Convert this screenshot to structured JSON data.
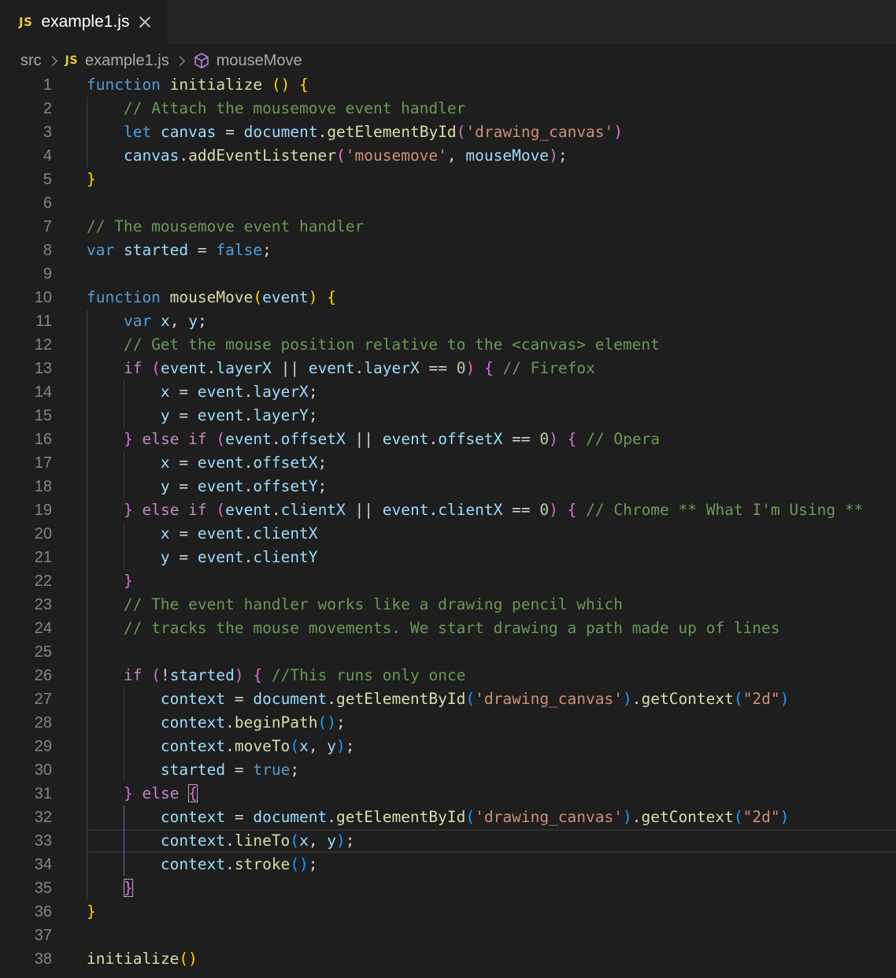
{
  "tab": {
    "badge": "JS",
    "title": "example1.js"
  },
  "breadcrumb": {
    "folder": "src",
    "file_badge": "JS",
    "file": "example1.js",
    "symbol": "mouseMove"
  },
  "colors": {
    "background": "#1e1e1e",
    "keyword": "#569cd6",
    "control": "#c586c0",
    "function": "#dcdcaa",
    "variable": "#9cdcfe",
    "string": "#ce9178",
    "comment": "#6a9955",
    "number": "#b5cea8",
    "bracket1": "#ffd700",
    "bracket2": "#da70d6",
    "bracket3": "#179fff",
    "js_badge": "#e8c93a"
  },
  "current_line": 33,
  "code": [
    [
      [
        "kw",
        "function"
      ],
      [
        "op",
        " "
      ],
      [
        "fn",
        "initialize"
      ],
      [
        "op",
        " "
      ],
      [
        "b1",
        "()"
      ],
      [
        "op",
        " "
      ],
      [
        "b1",
        "{"
      ]
    ],
    [
      [
        "op",
        "    "
      ],
      [
        "cmt",
        "// Attach the mousemove event handler"
      ]
    ],
    [
      [
        "op",
        "    "
      ],
      [
        "kw",
        "let"
      ],
      [
        "op",
        " "
      ],
      [
        "var",
        "canvas"
      ],
      [
        "op",
        " = "
      ],
      [
        "var",
        "document"
      ],
      [
        "op",
        "."
      ],
      [
        "fn",
        "getElementById"
      ],
      [
        "b2",
        "("
      ],
      [
        "str",
        "'drawing_canvas'"
      ],
      [
        "b2",
        ")"
      ]
    ],
    [
      [
        "op",
        "    "
      ],
      [
        "var",
        "canvas"
      ],
      [
        "op",
        "."
      ],
      [
        "fn",
        "addEventListener"
      ],
      [
        "b2",
        "("
      ],
      [
        "str",
        "'mousemove'"
      ],
      [
        "op",
        ", "
      ],
      [
        "var",
        "mouseMove"
      ],
      [
        "b2",
        ")"
      ],
      [
        "op",
        ";"
      ]
    ],
    [
      [
        "b1",
        "}"
      ]
    ],
    [],
    [
      [
        "cmt",
        "// The mousemove event handler"
      ]
    ],
    [
      [
        "kw",
        "var"
      ],
      [
        "op",
        " "
      ],
      [
        "var",
        "started"
      ],
      [
        "op",
        " = "
      ],
      [
        "kw",
        "false"
      ],
      [
        "op",
        ";"
      ]
    ],
    [],
    [
      [
        "kw",
        "function"
      ],
      [
        "op",
        " "
      ],
      [
        "fn",
        "mouseMove"
      ],
      [
        "b1",
        "("
      ],
      [
        "var",
        "event"
      ],
      [
        "b1",
        ")"
      ],
      [
        "op",
        " "
      ],
      [
        "b1",
        "{"
      ]
    ],
    [
      [
        "op",
        "    "
      ],
      [
        "kw",
        "var"
      ],
      [
        "op",
        " "
      ],
      [
        "var",
        "x"
      ],
      [
        "op",
        ", "
      ],
      [
        "var",
        "y"
      ],
      [
        "op",
        ";"
      ]
    ],
    [
      [
        "op",
        "    "
      ],
      [
        "cmt",
        "// Get the mouse position relative to the <canvas> element"
      ]
    ],
    [
      [
        "op",
        "    "
      ],
      [
        "ctl",
        "if"
      ],
      [
        "op",
        " "
      ],
      [
        "b2",
        "("
      ],
      [
        "var",
        "event"
      ],
      [
        "op",
        "."
      ],
      [
        "var",
        "layerX"
      ],
      [
        "op",
        " || "
      ],
      [
        "var",
        "event"
      ],
      [
        "op",
        "."
      ],
      [
        "var",
        "layerX"
      ],
      [
        "op",
        " == "
      ],
      [
        "num",
        "0"
      ],
      [
        "b2",
        ")"
      ],
      [
        "op",
        " "
      ],
      [
        "b2",
        "{"
      ],
      [
        "op",
        " "
      ],
      [
        "cmt",
        "// Firefox"
      ]
    ],
    [
      [
        "op",
        "        "
      ],
      [
        "var",
        "x"
      ],
      [
        "op",
        " = "
      ],
      [
        "var",
        "event"
      ],
      [
        "op",
        "."
      ],
      [
        "var",
        "layerX"
      ],
      [
        "op",
        ";"
      ]
    ],
    [
      [
        "op",
        "        "
      ],
      [
        "var",
        "y"
      ],
      [
        "op",
        " = "
      ],
      [
        "var",
        "event"
      ],
      [
        "op",
        "."
      ],
      [
        "var",
        "layerY"
      ],
      [
        "op",
        ";"
      ]
    ],
    [
      [
        "op",
        "    "
      ],
      [
        "b2",
        "}"
      ],
      [
        "op",
        " "
      ],
      [
        "ctl",
        "else if"
      ],
      [
        "op",
        " "
      ],
      [
        "b2",
        "("
      ],
      [
        "var",
        "event"
      ],
      [
        "op",
        "."
      ],
      [
        "var",
        "offsetX"
      ],
      [
        "op",
        " || "
      ],
      [
        "var",
        "event"
      ],
      [
        "op",
        "."
      ],
      [
        "var",
        "offsetX"
      ],
      [
        "op",
        " == "
      ],
      [
        "num",
        "0"
      ],
      [
        "b2",
        ")"
      ],
      [
        "op",
        " "
      ],
      [
        "b2",
        "{"
      ],
      [
        "op",
        " "
      ],
      [
        "cmt",
        "// Opera"
      ]
    ],
    [
      [
        "op",
        "        "
      ],
      [
        "var",
        "x"
      ],
      [
        "op",
        " = "
      ],
      [
        "var",
        "event"
      ],
      [
        "op",
        "."
      ],
      [
        "var",
        "offsetX"
      ],
      [
        "op",
        ";"
      ]
    ],
    [
      [
        "op",
        "        "
      ],
      [
        "var",
        "y"
      ],
      [
        "op",
        " = "
      ],
      [
        "var",
        "event"
      ],
      [
        "op",
        "."
      ],
      [
        "var",
        "offsetY"
      ],
      [
        "op",
        ";"
      ]
    ],
    [
      [
        "op",
        "    "
      ],
      [
        "b2",
        "}"
      ],
      [
        "op",
        " "
      ],
      [
        "ctl",
        "else if"
      ],
      [
        "op",
        " "
      ],
      [
        "b2",
        "("
      ],
      [
        "var",
        "event"
      ],
      [
        "op",
        "."
      ],
      [
        "var",
        "clientX"
      ],
      [
        "op",
        " || "
      ],
      [
        "var",
        "event"
      ],
      [
        "op",
        "."
      ],
      [
        "var",
        "clientX"
      ],
      [
        "op",
        " == "
      ],
      [
        "num",
        "0"
      ],
      [
        "b2",
        ")"
      ],
      [
        "op",
        " "
      ],
      [
        "b2",
        "{"
      ],
      [
        "op",
        " "
      ],
      [
        "cmt",
        "// Chrome ** What I'm Using **"
      ]
    ],
    [
      [
        "op",
        "        "
      ],
      [
        "var",
        "x"
      ],
      [
        "op",
        " = "
      ],
      [
        "var",
        "event"
      ],
      [
        "op",
        "."
      ],
      [
        "var",
        "clientX"
      ]
    ],
    [
      [
        "op",
        "        "
      ],
      [
        "var",
        "y"
      ],
      [
        "op",
        " = "
      ],
      [
        "var",
        "event"
      ],
      [
        "op",
        "."
      ],
      [
        "var",
        "clientY"
      ]
    ],
    [
      [
        "op",
        "    "
      ],
      [
        "b2",
        "}"
      ]
    ],
    [
      [
        "op",
        "    "
      ],
      [
        "cmt",
        "// The event handler works like a drawing pencil which"
      ]
    ],
    [
      [
        "op",
        "    "
      ],
      [
        "cmt",
        "// tracks the mouse movements. We start drawing a path made up of lines"
      ]
    ],
    [],
    [
      [
        "op",
        "    "
      ],
      [
        "ctl",
        "if"
      ],
      [
        "op",
        " "
      ],
      [
        "b2",
        "("
      ],
      [
        "op",
        "!"
      ],
      [
        "var",
        "started"
      ],
      [
        "b2",
        ")"
      ],
      [
        "op",
        " "
      ],
      [
        "b2",
        "{"
      ],
      [
        "op",
        " "
      ],
      [
        "cmt",
        "//This runs only once"
      ]
    ],
    [
      [
        "op",
        "        "
      ],
      [
        "var",
        "context"
      ],
      [
        "op",
        " = "
      ],
      [
        "var",
        "document"
      ],
      [
        "op",
        "."
      ],
      [
        "fn",
        "getElementById"
      ],
      [
        "b3",
        "("
      ],
      [
        "str",
        "'drawing_canvas'"
      ],
      [
        "b3",
        ")"
      ],
      [
        "op",
        "."
      ],
      [
        "fn",
        "getContext"
      ],
      [
        "b3",
        "("
      ],
      [
        "str",
        "\"2d\""
      ],
      [
        "b3",
        ")"
      ]
    ],
    [
      [
        "op",
        "        "
      ],
      [
        "var",
        "context"
      ],
      [
        "op",
        "."
      ],
      [
        "fn",
        "beginPath"
      ],
      [
        "b3",
        "()"
      ],
      [
        "op",
        ";"
      ]
    ],
    [
      [
        "op",
        "        "
      ],
      [
        "var",
        "context"
      ],
      [
        "op",
        "."
      ],
      [
        "fn",
        "moveTo"
      ],
      [
        "b3",
        "("
      ],
      [
        "var",
        "x"
      ],
      [
        "op",
        ", "
      ],
      [
        "var",
        "y"
      ],
      [
        "b3",
        ")"
      ],
      [
        "op",
        ";"
      ]
    ],
    [
      [
        "op",
        "        "
      ],
      [
        "var",
        "started"
      ],
      [
        "op",
        " = "
      ],
      [
        "kw",
        "true"
      ],
      [
        "op",
        ";"
      ]
    ],
    [
      [
        "op",
        "    "
      ],
      [
        "b2",
        "}"
      ],
      [
        "op",
        " "
      ],
      [
        "ctl",
        "else"
      ],
      [
        "op",
        " "
      ],
      [
        "b2 box",
        "{"
      ]
    ],
    [
      [
        "op",
        "        "
      ],
      [
        "var",
        "context"
      ],
      [
        "op",
        " = "
      ],
      [
        "var",
        "document"
      ],
      [
        "op",
        "."
      ],
      [
        "fn",
        "getElementById"
      ],
      [
        "b3",
        "("
      ],
      [
        "str",
        "'drawing_canvas'"
      ],
      [
        "b3",
        ")"
      ],
      [
        "op",
        "."
      ],
      [
        "fn",
        "getContext"
      ],
      [
        "b3",
        "("
      ],
      [
        "str",
        "\"2d\""
      ],
      [
        "b3",
        ")"
      ]
    ],
    [
      [
        "op",
        "        "
      ],
      [
        "var",
        "context"
      ],
      [
        "op",
        "."
      ],
      [
        "fn",
        "lineTo"
      ],
      [
        "b3",
        "("
      ],
      [
        "var",
        "x"
      ],
      [
        "op",
        ", "
      ],
      [
        "var",
        "y"
      ],
      [
        "b3",
        ")"
      ],
      [
        "op",
        ";"
      ]
    ],
    [
      [
        "op",
        "        "
      ],
      [
        "var",
        "context"
      ],
      [
        "op",
        "."
      ],
      [
        "fn",
        "stroke"
      ],
      [
        "b3",
        "()"
      ],
      [
        "op",
        ";"
      ]
    ],
    [
      [
        "op",
        "    "
      ],
      [
        "b2 box",
        "}"
      ]
    ],
    [
      [
        "b1",
        "}"
      ]
    ],
    [],
    [
      [
        "fn",
        "initialize"
      ],
      [
        "b1",
        "()"
      ]
    ]
  ]
}
